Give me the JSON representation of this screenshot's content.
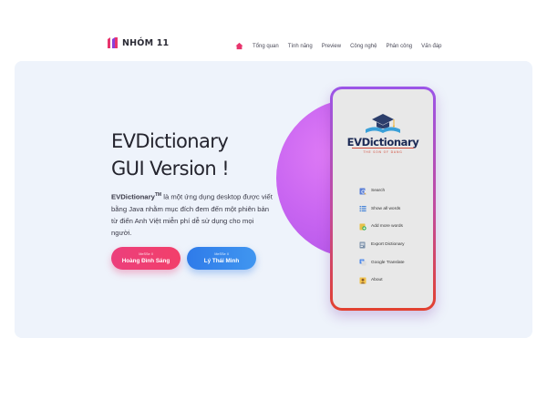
{
  "logo": {
    "text": "NHÓM 11"
  },
  "nav": {
    "items": [
      {
        "label": "Tổng quan"
      },
      {
        "label": "Tính năng"
      },
      {
        "label": "Preview"
      },
      {
        "label": "Công nghệ"
      },
      {
        "label": "Phân công"
      },
      {
        "label": "Vấn đáp"
      }
    ]
  },
  "hero": {
    "title_line1": "EVDictionary",
    "title_line2": "GUI Version !",
    "desc_brand": "EVDictionary",
    "desc_tm": "TM",
    "desc_rest": " là một ứng dụng desktop được viết bằng Java nhằm mục đích đem đến một phiên bản từ điển Anh Việt miễn phí dễ sử dụng cho mọi người.",
    "buttons": [
      {
        "role": "MeSSe II",
        "name": "Hoàng Đình Sáng"
      },
      {
        "role": "MeSSe II",
        "name": "Lý Thái Minh"
      }
    ]
  },
  "phone": {
    "app_logo_text": "EVDictionary",
    "app_logo_sub": "THE SON OF DANG",
    "menu": [
      {
        "label": "Search",
        "icon": "search-icon"
      },
      {
        "label": "Show all words",
        "icon": "list-icon"
      },
      {
        "label": "Add more words",
        "icon": "add-icon"
      },
      {
        "label": "Export Dictionary",
        "icon": "export-icon"
      },
      {
        "label": "Google Translate",
        "icon": "translate-icon"
      },
      {
        "label": "About",
        "icon": "user-icon"
      }
    ]
  },
  "colors": {
    "accent_pink": "#ec3f7c",
    "accent_blue": "#2f7be9",
    "circle_purple": "#c865f1",
    "hero_bg": "#eef3fb"
  }
}
